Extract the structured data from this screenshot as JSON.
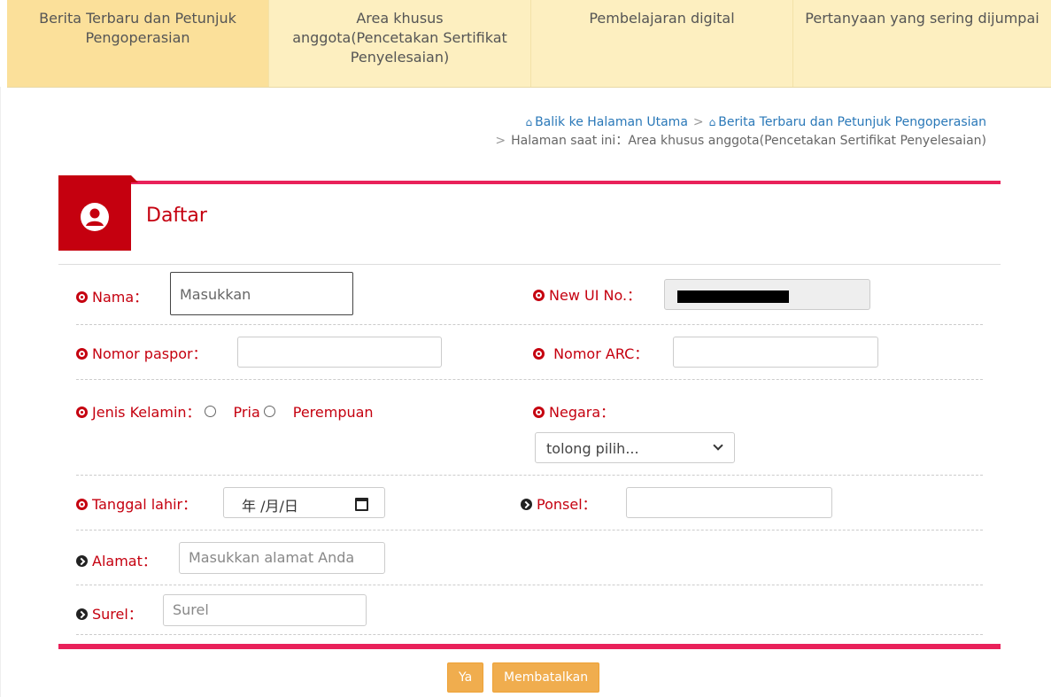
{
  "nav": {
    "tabs": [
      {
        "label": "Berita Terbaru dan Petunjuk Pengoperasian"
      },
      {
        "label": "Area khusus anggota(Pencetakan Sertifikat Penyelesaian)"
      },
      {
        "label": "Pembelajaran digital"
      },
      {
        "label": "Pertanyaan yang sering dijumpai"
      }
    ]
  },
  "breadcrumb": {
    "home": "Balik ke Halaman Utama",
    "sep": ">",
    "section": "Berita Terbaru dan Petunjuk Pengoperasian",
    "current_prefix": "Halaman saat ini：",
    "current": "Area khusus anggota(Pencetakan Sertifikat Penyelesaian)"
  },
  "form": {
    "title": "Daftar",
    "nama_label": "Nama：",
    "nama_value": "Masukkan",
    "ui_label": "New UI No.：",
    "paspor_label": "Nomor paspor：",
    "arc_label": " Nomor ARC：",
    "gender_label": "Jenis Kelamin：",
    "gender_male": "Pria",
    "gender_female": "Perempuan",
    "negara_label": "Negara：",
    "negara_value": "tolong pilih...",
    "dob_label": "Tanggal lahir：",
    "dob_value": "年 /月/日",
    "ponsel_label": "Ponsel：",
    "alamat_label": "Alamat：",
    "alamat_placeholder": "Masukkan alamat Anda",
    "surel_label": "Surel：",
    "surel_placeholder": "Surel"
  },
  "buttons": {
    "confirm": "Ya",
    "cancel": "Membatalkan"
  },
  "colors": {
    "accent_red": "#c5000f",
    "pink_line": "#e9215a",
    "nav_bg": "#fdefc0",
    "button_orange": "#f0ad4e"
  }
}
